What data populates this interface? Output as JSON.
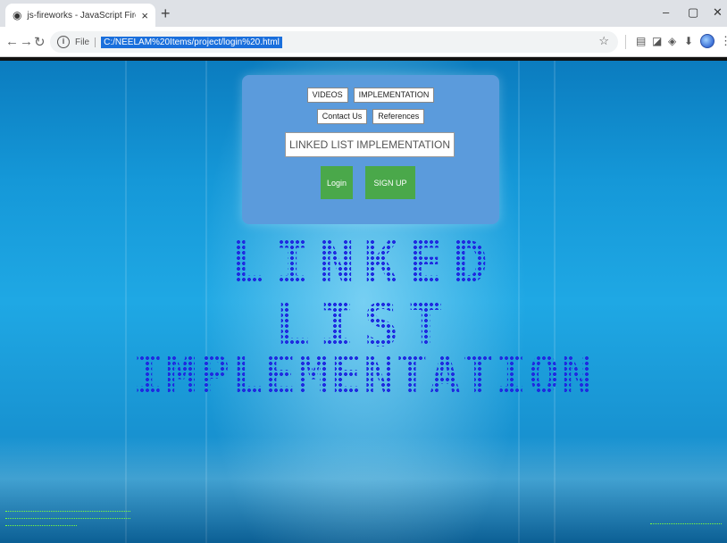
{
  "browser": {
    "tab_title": "js-fireworks - JavaScript Firework",
    "new_tab_symbol": "+",
    "scheme_label": "File",
    "url": "C:/NEELAM%20Items/project/login%20.html",
    "window_controls": [
      "–",
      "▢",
      "✕"
    ],
    "icons": [
      "back-arrow-icon",
      "forward-arrow-icon",
      "reload-icon",
      "info-icon",
      "star-icon",
      "extension-icon",
      "puzzle-icon",
      "download-icon",
      "profile-icon",
      "menu-dots-icon"
    ]
  },
  "nav": {
    "row1": [
      "VIDEOS",
      "IMPLEMENTATION"
    ],
    "row2": [
      "Contact Us",
      "References"
    ]
  },
  "main": {
    "heading_box": "LINKED LIST IMPLEMENTATION",
    "login_label": "Login",
    "signup_label": "SIGN UP"
  },
  "banner": {
    "line1": "LINKED",
    "line2": "LIST",
    "line3": "IMPLEMENTATION"
  },
  "colors": {
    "background": "#1598d8",
    "card": "#5b9bdc",
    "button_green": "#4aa84a",
    "dot_text": "#1f2be0",
    "footer_text": "#7cff3a"
  }
}
